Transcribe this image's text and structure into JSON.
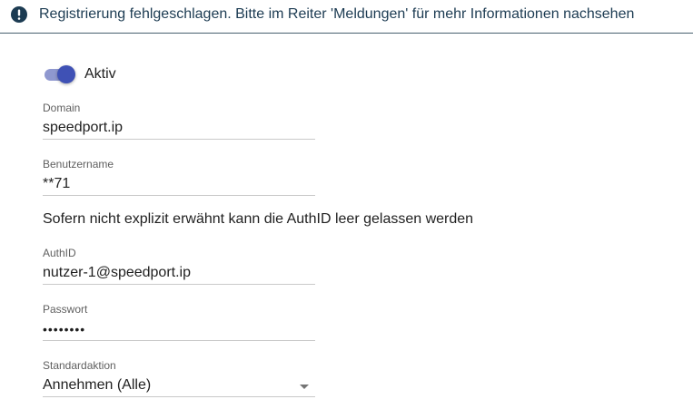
{
  "banner": {
    "icon": "alert-circle-icon",
    "text": "Registrierung fehlgeschlagen. Bitte im Reiter 'Meldungen' für mehr Informationen nachsehen"
  },
  "active_toggle": {
    "label": "Aktiv",
    "checked": true,
    "accent_color": "#3f51b5"
  },
  "fields": {
    "domain": {
      "label": "Domain",
      "value": "speedport.ip"
    },
    "username": {
      "label": "Benutzername",
      "value": "**71"
    },
    "hint": "Sofern nicht explizit erwähnt kann die AuthID leer gelassen werden",
    "authid": {
      "label": "AuthID",
      "value": "nutzer-1@speedport.ip"
    },
    "password": {
      "label": "Passwort",
      "value": "••••••••"
    },
    "default_action": {
      "label": "Standardaktion",
      "value": "Annehmen (Alle)",
      "icon": "dropdown-arrow-icon"
    }
  }
}
